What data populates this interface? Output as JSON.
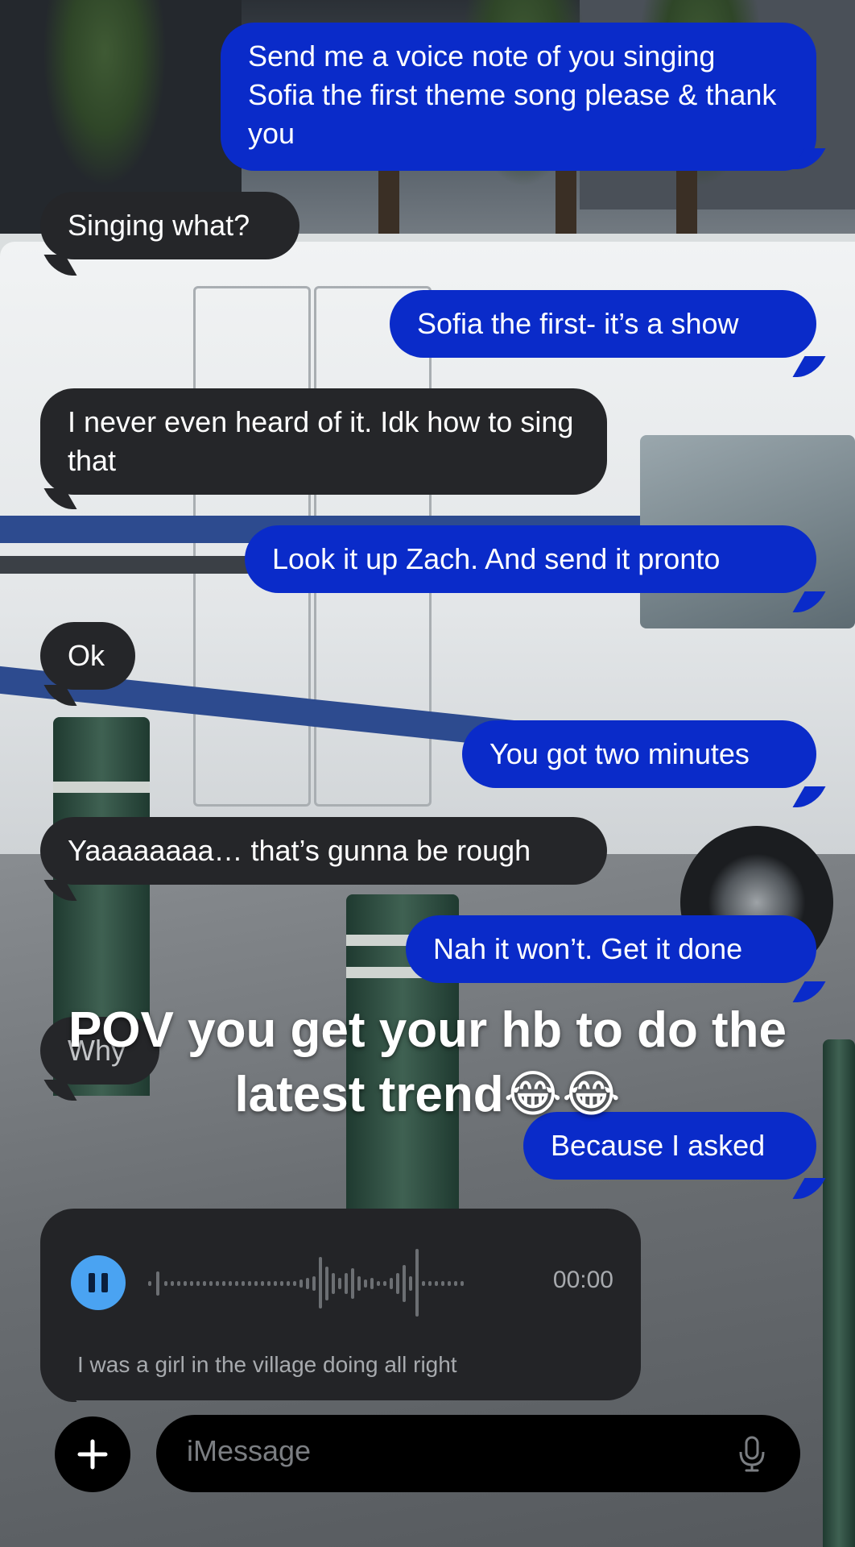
{
  "overlay": {
    "title_line1": "POV you get your hb to do the",
    "title_line2": "latest trend😂😂"
  },
  "messages": [
    {
      "direction": "outgoing",
      "text": "Send me a voice note of you singing Sofia the first theme song please & thank you"
    },
    {
      "direction": "incoming",
      "text": "Singing what?"
    },
    {
      "direction": "outgoing",
      "text": "Sofia the first- it’s a show"
    },
    {
      "direction": "incoming",
      "text": "I never even heard of it. Idk how to sing that"
    },
    {
      "direction": "outgoing",
      "text": "Look it up Zach. And send it pronto"
    },
    {
      "direction": "incoming",
      "text": "Ok"
    },
    {
      "direction": "outgoing",
      "text": "You got two minutes"
    },
    {
      "direction": "incoming",
      "text": "Yaaaaaaaa… that’s gunna be rough"
    },
    {
      "direction": "outgoing",
      "text": "Nah it won’t. Get it done"
    },
    {
      "direction": "incoming",
      "text": "Why"
    },
    {
      "direction": "outgoing",
      "text": "Because I asked"
    }
  ],
  "voice_note": {
    "state_icon": "pause-icon",
    "time": "00:00",
    "transcript": "I was a girl in the village doing all right"
  },
  "compose": {
    "placeholder": "iMessage",
    "add_icon": "plus-icon",
    "mic_icon": "microphone-icon"
  },
  "colors": {
    "outgoing_bubble": "#0a2bc9",
    "incoming_bubble": "#252629",
    "accent": "#4aa3f2"
  }
}
